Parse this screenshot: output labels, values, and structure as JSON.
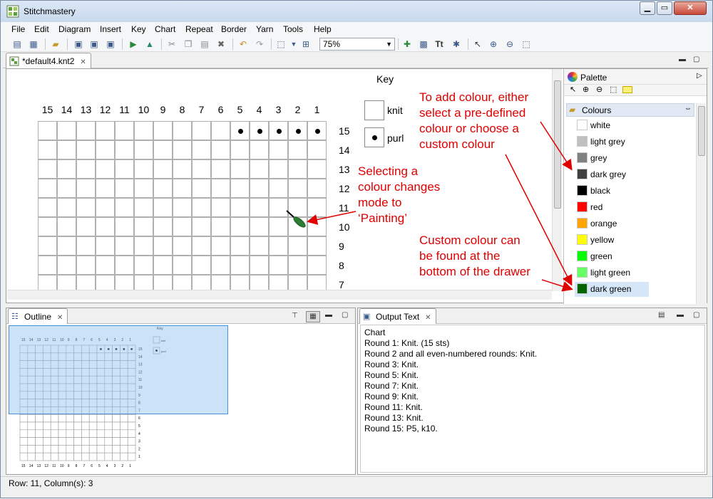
{
  "app": {
    "title": "Stitchmastery"
  },
  "window_buttons": {
    "minimize": "▁",
    "restore": "▭",
    "close": "✕"
  },
  "menu": [
    "File",
    "Edit",
    "Diagram",
    "Insert",
    "Key",
    "Chart",
    "Repeat",
    "Border",
    "Yarn",
    "Tools",
    "Help"
  ],
  "toolbar": {
    "zoom_value": "75%"
  },
  "editor": {
    "tab_label": "*default4.knt2",
    "tab_close": "✕",
    "column_numbers": [
      "15",
      "14",
      "13",
      "12",
      "11",
      "10",
      "9",
      "8",
      "7",
      "6",
      "5",
      "4",
      "3",
      "2",
      "1"
    ],
    "row_numbers": [
      "15",
      "14",
      "13",
      "12",
      "11",
      "10",
      "9",
      "8",
      "7"
    ],
    "purl_cells": {
      "row": "15",
      "columns": [
        "5",
        "4",
        "3",
        "2",
        "1"
      ]
    },
    "key": {
      "title": "Key",
      "items": [
        {
          "label": "knit",
          "symbol": ""
        },
        {
          "label": "purl",
          "symbol": "•"
        }
      ]
    }
  },
  "annotations": {
    "add_colour": [
      "To add colour, either",
      "select a pre-defined",
      "colour or choose a",
      "custom colour"
    ],
    "painting_mode": [
      "Selecting a",
      "colour changes",
      "mode to",
      "‘Painting’"
    ],
    "custom_colour": [
      "Custom colour can",
      "be found at the",
      "bottom of the drawer"
    ]
  },
  "palette": {
    "title": "Palette",
    "drawer_title": "Colours",
    "colours": [
      {
        "name": "white",
        "hex": "#ffffff"
      },
      {
        "name": "light grey",
        "hex": "#c0c0c0"
      },
      {
        "name": "grey",
        "hex": "#808080"
      },
      {
        "name": "dark grey",
        "hex": "#404040"
      },
      {
        "name": "black",
        "hex": "#000000"
      },
      {
        "name": "red",
        "hex": "#ff0000"
      },
      {
        "name": "orange",
        "hex": "#ffa500"
      },
      {
        "name": "yellow",
        "hex": "#ffff00"
      },
      {
        "name": "green",
        "hex": "#00ff00"
      },
      {
        "name": "light green",
        "hex": "#66ff66"
      },
      {
        "name": "dark green",
        "hex": "#006400"
      }
    ],
    "selected": "dark green"
  },
  "outline": {
    "tab_label": "Outline",
    "tab_close": "✕",
    "key_title": "Key",
    "key_items": [
      "knit",
      "purl"
    ]
  },
  "output": {
    "tab_label": "Output Text",
    "tab_close": "✕",
    "lines": [
      "Chart",
      "Round 1: Knit. (15 sts)",
      "Round 2 and all even-numbered rounds: Knit.",
      "Round 3: Knit.",
      "Round 5: Knit.",
      "Round 7: Knit.",
      "Round 9: Knit.",
      "Round 11: Knit.",
      "Round 13: Knit.",
      "Round 15: P5, k10."
    ]
  },
  "status": {
    "text": "Row: 11, Column(s): 3"
  },
  "colors": {
    "annotation": "#e00000",
    "selection": "#d6e6f9"
  }
}
